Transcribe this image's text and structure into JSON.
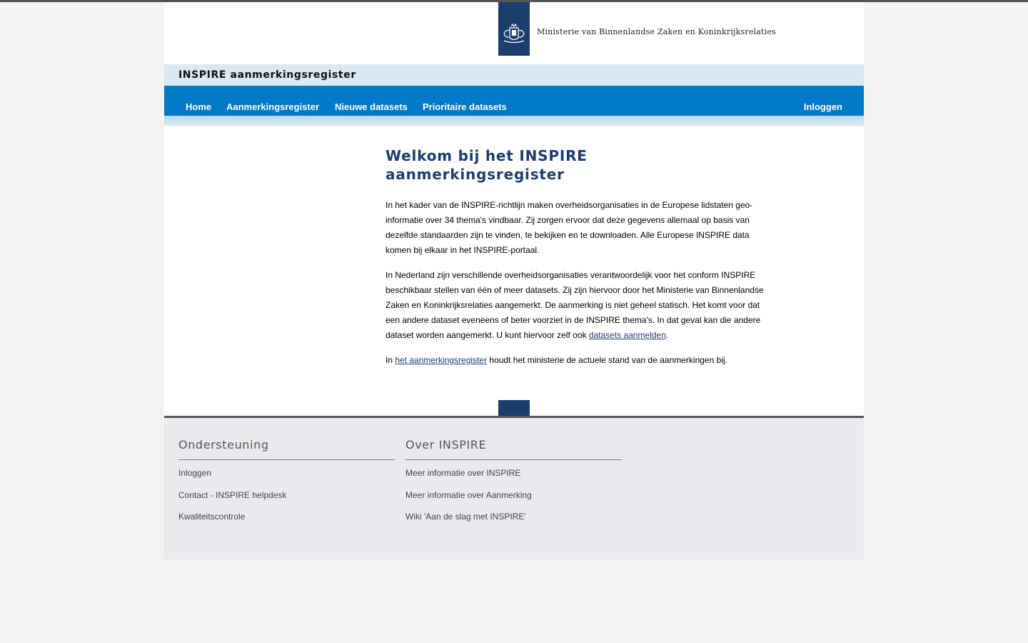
{
  "header": {
    "ministry": "Ministerie van Binnenlandse Zaken en Koninkrijksrelaties",
    "app_title": "INSPIRE aanmerkingsregister"
  },
  "nav": {
    "items": [
      "Home",
      "Aanmerkingsregister",
      "Nieuwe datasets",
      "Prioritaire datasets"
    ],
    "login": "Inloggen"
  },
  "main": {
    "heading": "Welkom bij het INSPIRE aanmerkingsregister",
    "p1": "In het kader van de INSPIRE-richtlijn maken overheidsorganisaties in de Europese lidstaten geo-informatie over 34 thema's vindbaar. Zij zorgen ervoor dat deze gegevens allemaal op basis van dezelfde standaarden zijn te vinden, te bekijken en te downloaden. Alle Europese INSPIRE data komen bij elkaar in het INSPIRE-portaal.",
    "p2_text": "In Nederland zijn verschillende overheidsorganisaties verantwoordelijk voor het conform INSPIRE beschikbaar stellen van één of meer datasets. Zij zijn hiervoor door het Ministerie van Binnenlandse Zaken en Koninkrijksrelaties aangemerkt. De aanmerking is niet geheel statisch. Het komt voor dat een andere dataset eveneens of beter voorziet in de INSPIRE thema's. In dat geval kan die andere dataset worden aangemerkt. U kunt hiervoor zelf ook ",
    "p2_link": "datasets aanmelden",
    "p2_end": ".",
    "p3_start": "In ",
    "p3_link": "het aanmerkingsregister",
    "p3_end": " houdt het ministerie de actuele stand van de aanmerkingen bij."
  },
  "footer": {
    "support": {
      "title": "Ondersteuning",
      "links": [
        "Inloggen",
        "Contact - INSPIRE helpdesk",
        "Kwaliteitscontrole"
      ]
    },
    "about": {
      "title": "Over INSPIRE",
      "links": [
        "Meer informatie over INSPIRE",
        "Meer informatie over Aanmerking",
        "Wiki 'Aan de slag met INSPIRE'"
      ]
    }
  },
  "colors": {
    "brand": "#1b3e6f",
    "nav": "#0079c8",
    "title_bar": "#d9e9f4"
  }
}
